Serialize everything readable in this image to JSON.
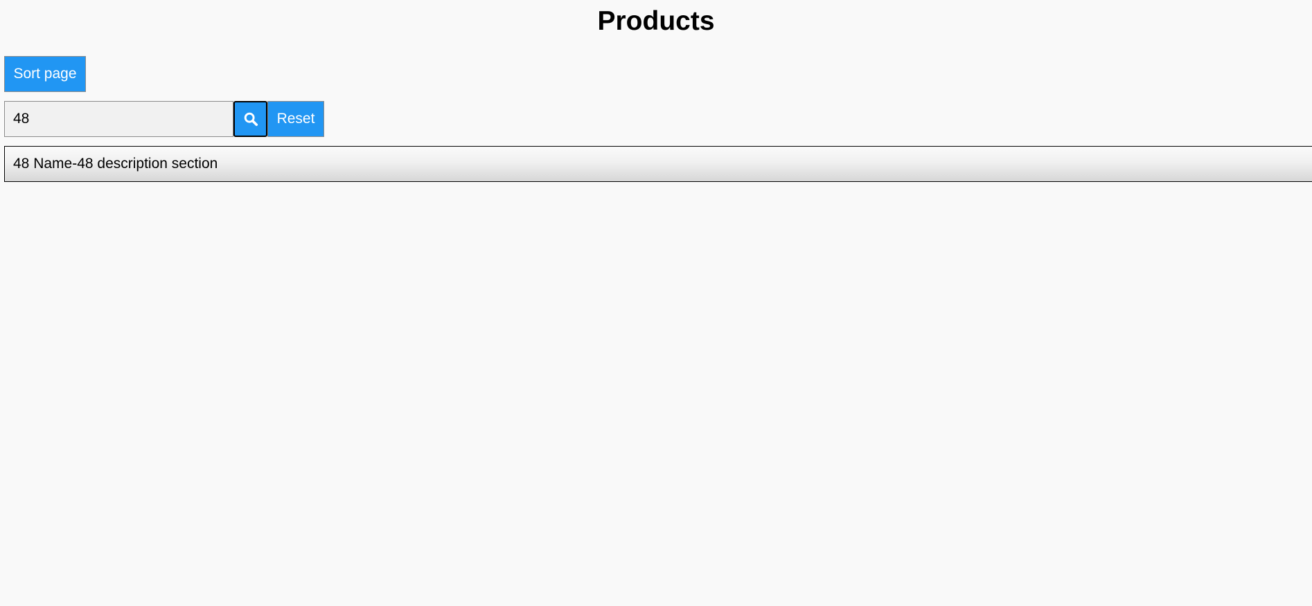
{
  "page": {
    "title": "Products"
  },
  "toolbar": {
    "sort_label": "Sort page"
  },
  "search": {
    "value": "48",
    "placeholder": "",
    "search_icon": "search-icon",
    "reset_label": "Reset"
  },
  "results": [
    {
      "text": "48 Name-48 description section"
    }
  ],
  "colors": {
    "accent": "#2196f3",
    "background": "#f9f9f9"
  }
}
